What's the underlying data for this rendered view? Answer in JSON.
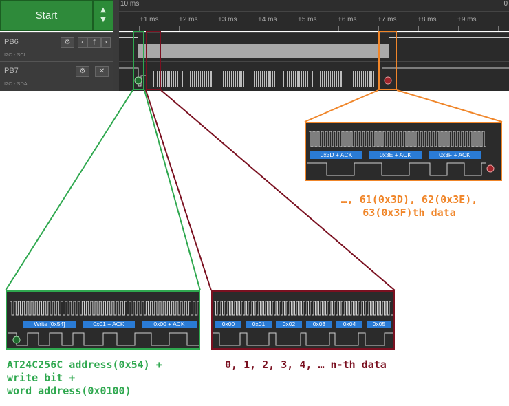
{
  "toolbar": {
    "start_label": "Start",
    "timebase": "10 ms",
    "end_mark": "0"
  },
  "ruler": {
    "ticks": [
      "+1 ms",
      "+2 ms",
      "+3 ms",
      "+4 ms",
      "+5 ms",
      "+6 ms",
      "+7 ms",
      "+8 ms",
      "+9 ms"
    ]
  },
  "channels": [
    {
      "name": "PB6",
      "analyzer": "I2C - SCL"
    },
    {
      "name": "PB7",
      "analyzer": "I2C - SDA"
    }
  ],
  "zooms": {
    "start": {
      "labels": [
        "Write [0x54]",
        "0x01 + ACK",
        "0x00 + ACK"
      ],
      "note": [
        "AT24C256C address(0x54) +",
        "write bit +",
        "word address(0x0100)"
      ]
    },
    "data": {
      "labels": [
        "0x00",
        "0x01",
        "0x02",
        "0x03",
        "0x04",
        "0x05"
      ],
      "note": [
        "0, 1, 2, 3, 4, … n-th data"
      ]
    },
    "end": {
      "labels": [
        "0x3D + ACK",
        "0x3E + ACK",
        "0x3F + ACK"
      ],
      "note": [
        "…, 61(0x3D), 62(0x3E),",
        "63(0x3F)th data"
      ]
    }
  },
  "colors": {
    "start": "#2fa84f",
    "data": "#7a1020",
    "end": "#f0862a",
    "decode": "#2a7bd5"
  }
}
